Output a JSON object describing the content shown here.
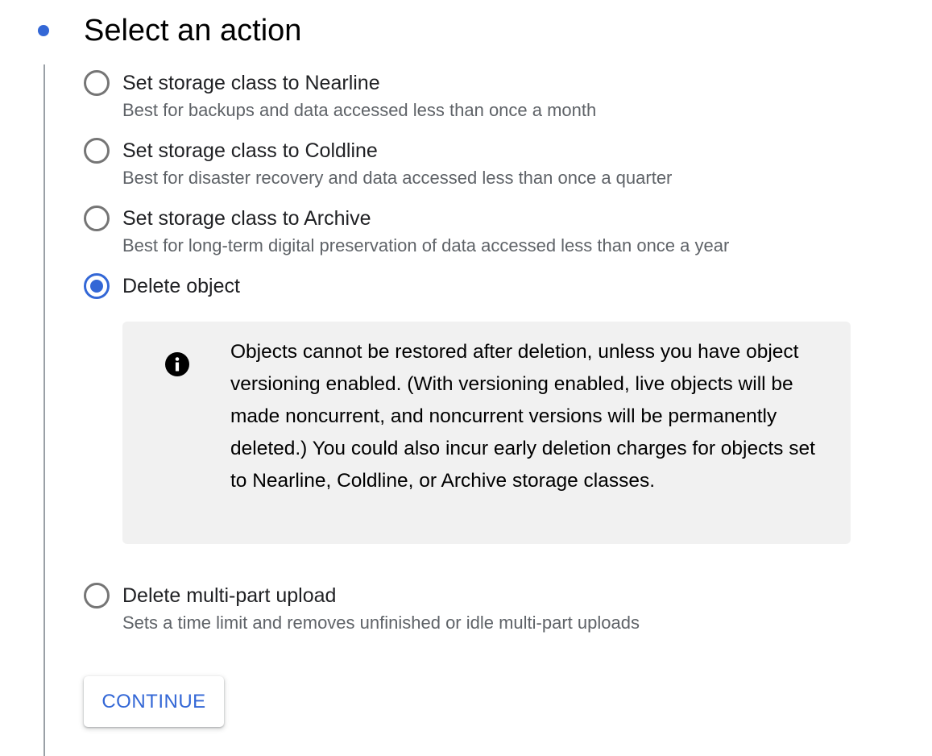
{
  "step": {
    "title": "Select an action",
    "accent_color": "#3367d6"
  },
  "options": [
    {
      "label": "Set storage class to Nearline",
      "description": "Best for backups and data accessed less than once a month",
      "selected": false
    },
    {
      "label": "Set storage class to Coldline",
      "description": "Best for disaster recovery and data accessed less than once a quarter",
      "selected": false
    },
    {
      "label": "Set storage class to Archive",
      "description": "Best for long-term digital preservation of data accessed less than once a year",
      "selected": false
    },
    {
      "label": "Delete object",
      "description": "",
      "selected": true
    },
    {
      "label": "Delete multi-part upload",
      "description": "Sets a time limit and removes unfinished or idle multi-part uploads",
      "selected": false
    }
  ],
  "info_notice": {
    "icon": "info-icon",
    "text": "Objects cannot be restored after deletion, unless you have object versioning enabled. (With versioning enabled, live objects will be made noncurrent, and noncurrent versions will be permanently deleted.) You could also incur early deletion charges for objects set to Nearline, Coldline, or Archive storage classes."
  },
  "actions": {
    "continue_label": "CONTINUE"
  }
}
